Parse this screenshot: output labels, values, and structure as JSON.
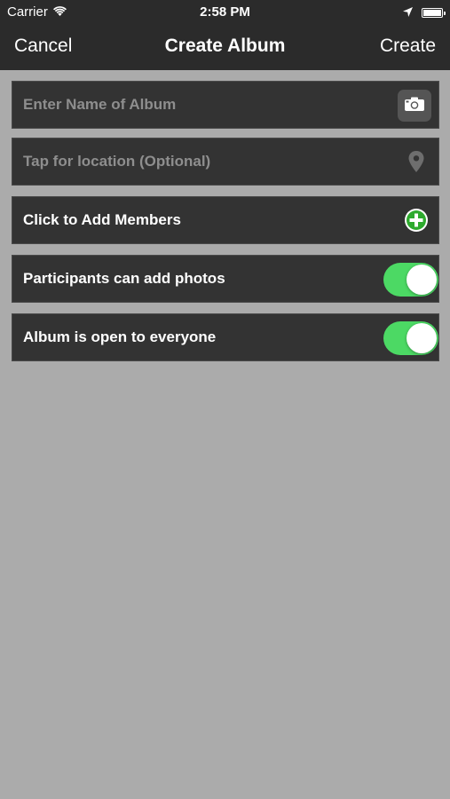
{
  "status_bar": {
    "carrier": "Carrier",
    "time": "2:58 PM",
    "icons": [
      "wifi-icon",
      "location-arrow-icon",
      "battery-icon"
    ]
  },
  "nav": {
    "left_label": "Cancel",
    "title": "Create Album",
    "right_label": "Create"
  },
  "form": {
    "album_name": {
      "value": "",
      "placeholder": "Enter Name of Album",
      "icon": "camera-icon"
    },
    "location": {
      "placeholder": "Tap for location (Optional)",
      "icon": "map-pin-icon"
    },
    "members": {
      "label": "Click to Add Members",
      "icon": "add-circle-icon"
    },
    "participants_can_add_photos": {
      "label": "Participants can add photos",
      "on": true
    },
    "album_open_to_everyone": {
      "label": "Album is open to everyone",
      "on": true
    }
  },
  "colors": {
    "background": "#ababab",
    "topbar": "#2b2b2b",
    "row": "#333333",
    "toggle_on": "#4cd964",
    "add_icon": "#2eaa2e"
  }
}
